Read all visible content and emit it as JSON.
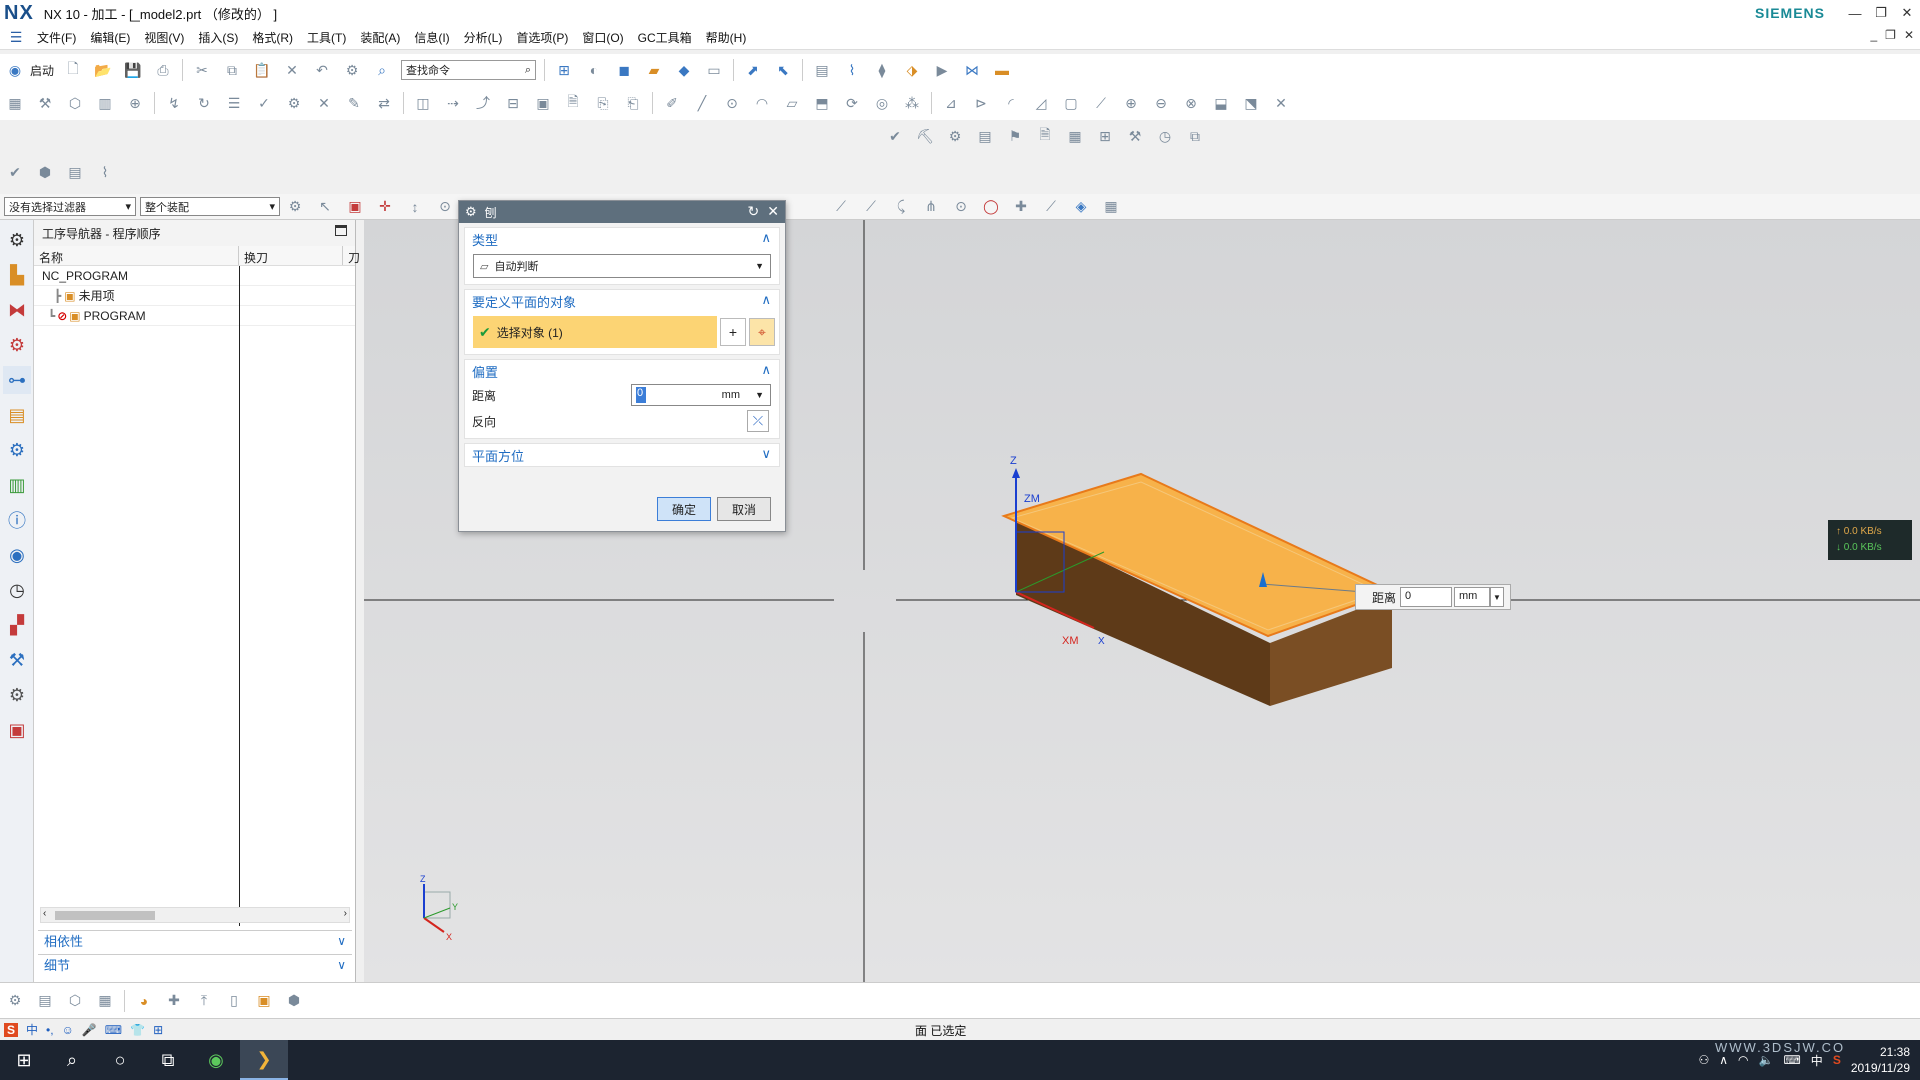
{
  "window": {
    "logo": "NX",
    "title": "NX 10 - 加工 - [_model2.prt （修改的） ]",
    "brand": "SIEMENS"
  },
  "menubar": {
    "items": [
      "文件(F)",
      "编辑(E)",
      "视图(V)",
      "插入(S)",
      "格式(R)",
      "工具(T)",
      "装配(A)",
      "信息(I)",
      "分析(L)",
      "首选项(P)",
      "窗口(O)",
      "GC工具箱",
      "帮助(H)"
    ]
  },
  "toolbar": {
    "start_label": "启动",
    "search_placeholder": "查找命令"
  },
  "selection_bar": {
    "filter": "没有选择过滤器",
    "scope": "整个装配"
  },
  "navigator": {
    "title": "工序导航器 - 程序顺序",
    "columns": [
      "名称",
      "换刀",
      "刀"
    ],
    "rows": [
      {
        "label": "NC_PROGRAM"
      },
      {
        "label": "未用项"
      },
      {
        "label": "PROGRAM"
      }
    ],
    "sections": [
      "相依性",
      "细节"
    ]
  },
  "dialog": {
    "title": "刨",
    "groups": {
      "type": {
        "label": "类型",
        "value": "自动判断"
      },
      "objects": {
        "label": "要定义平面的对象",
        "select_label": "选择对象 (1)"
      },
      "offset": {
        "label": "偏置",
        "distance_label": "距离",
        "distance_value": "0",
        "unit": "mm",
        "reverse_label": "反向"
      },
      "orientation": {
        "label": "平面方位"
      }
    },
    "ok_label": "确定",
    "cancel_label": "取消"
  },
  "float_distance": {
    "label": "距离",
    "value": "0",
    "unit": "mm"
  },
  "triad": {
    "z": "Z",
    "zm": "ZM",
    "xm": "XM",
    "x": "X",
    "y": "Y"
  },
  "netspeed": {
    "up": "↑ 0.0 KB/s",
    "down": "↓ 0.0 KB/s"
  },
  "statusbar": {
    "ime_label": "中",
    "status": "面 已选定"
  },
  "taskbar": {
    "ime": "中",
    "time": "21:38",
    "date": "2019/11/29"
  },
  "watermark": "WWW.3DSJW.CO",
  "colors": {
    "accent": "#1f6cc2",
    "selection": "#fcd474",
    "face_top": "#f7b24a",
    "face_side": "#6b431d",
    "dialog_title": "#5e6f7d"
  }
}
